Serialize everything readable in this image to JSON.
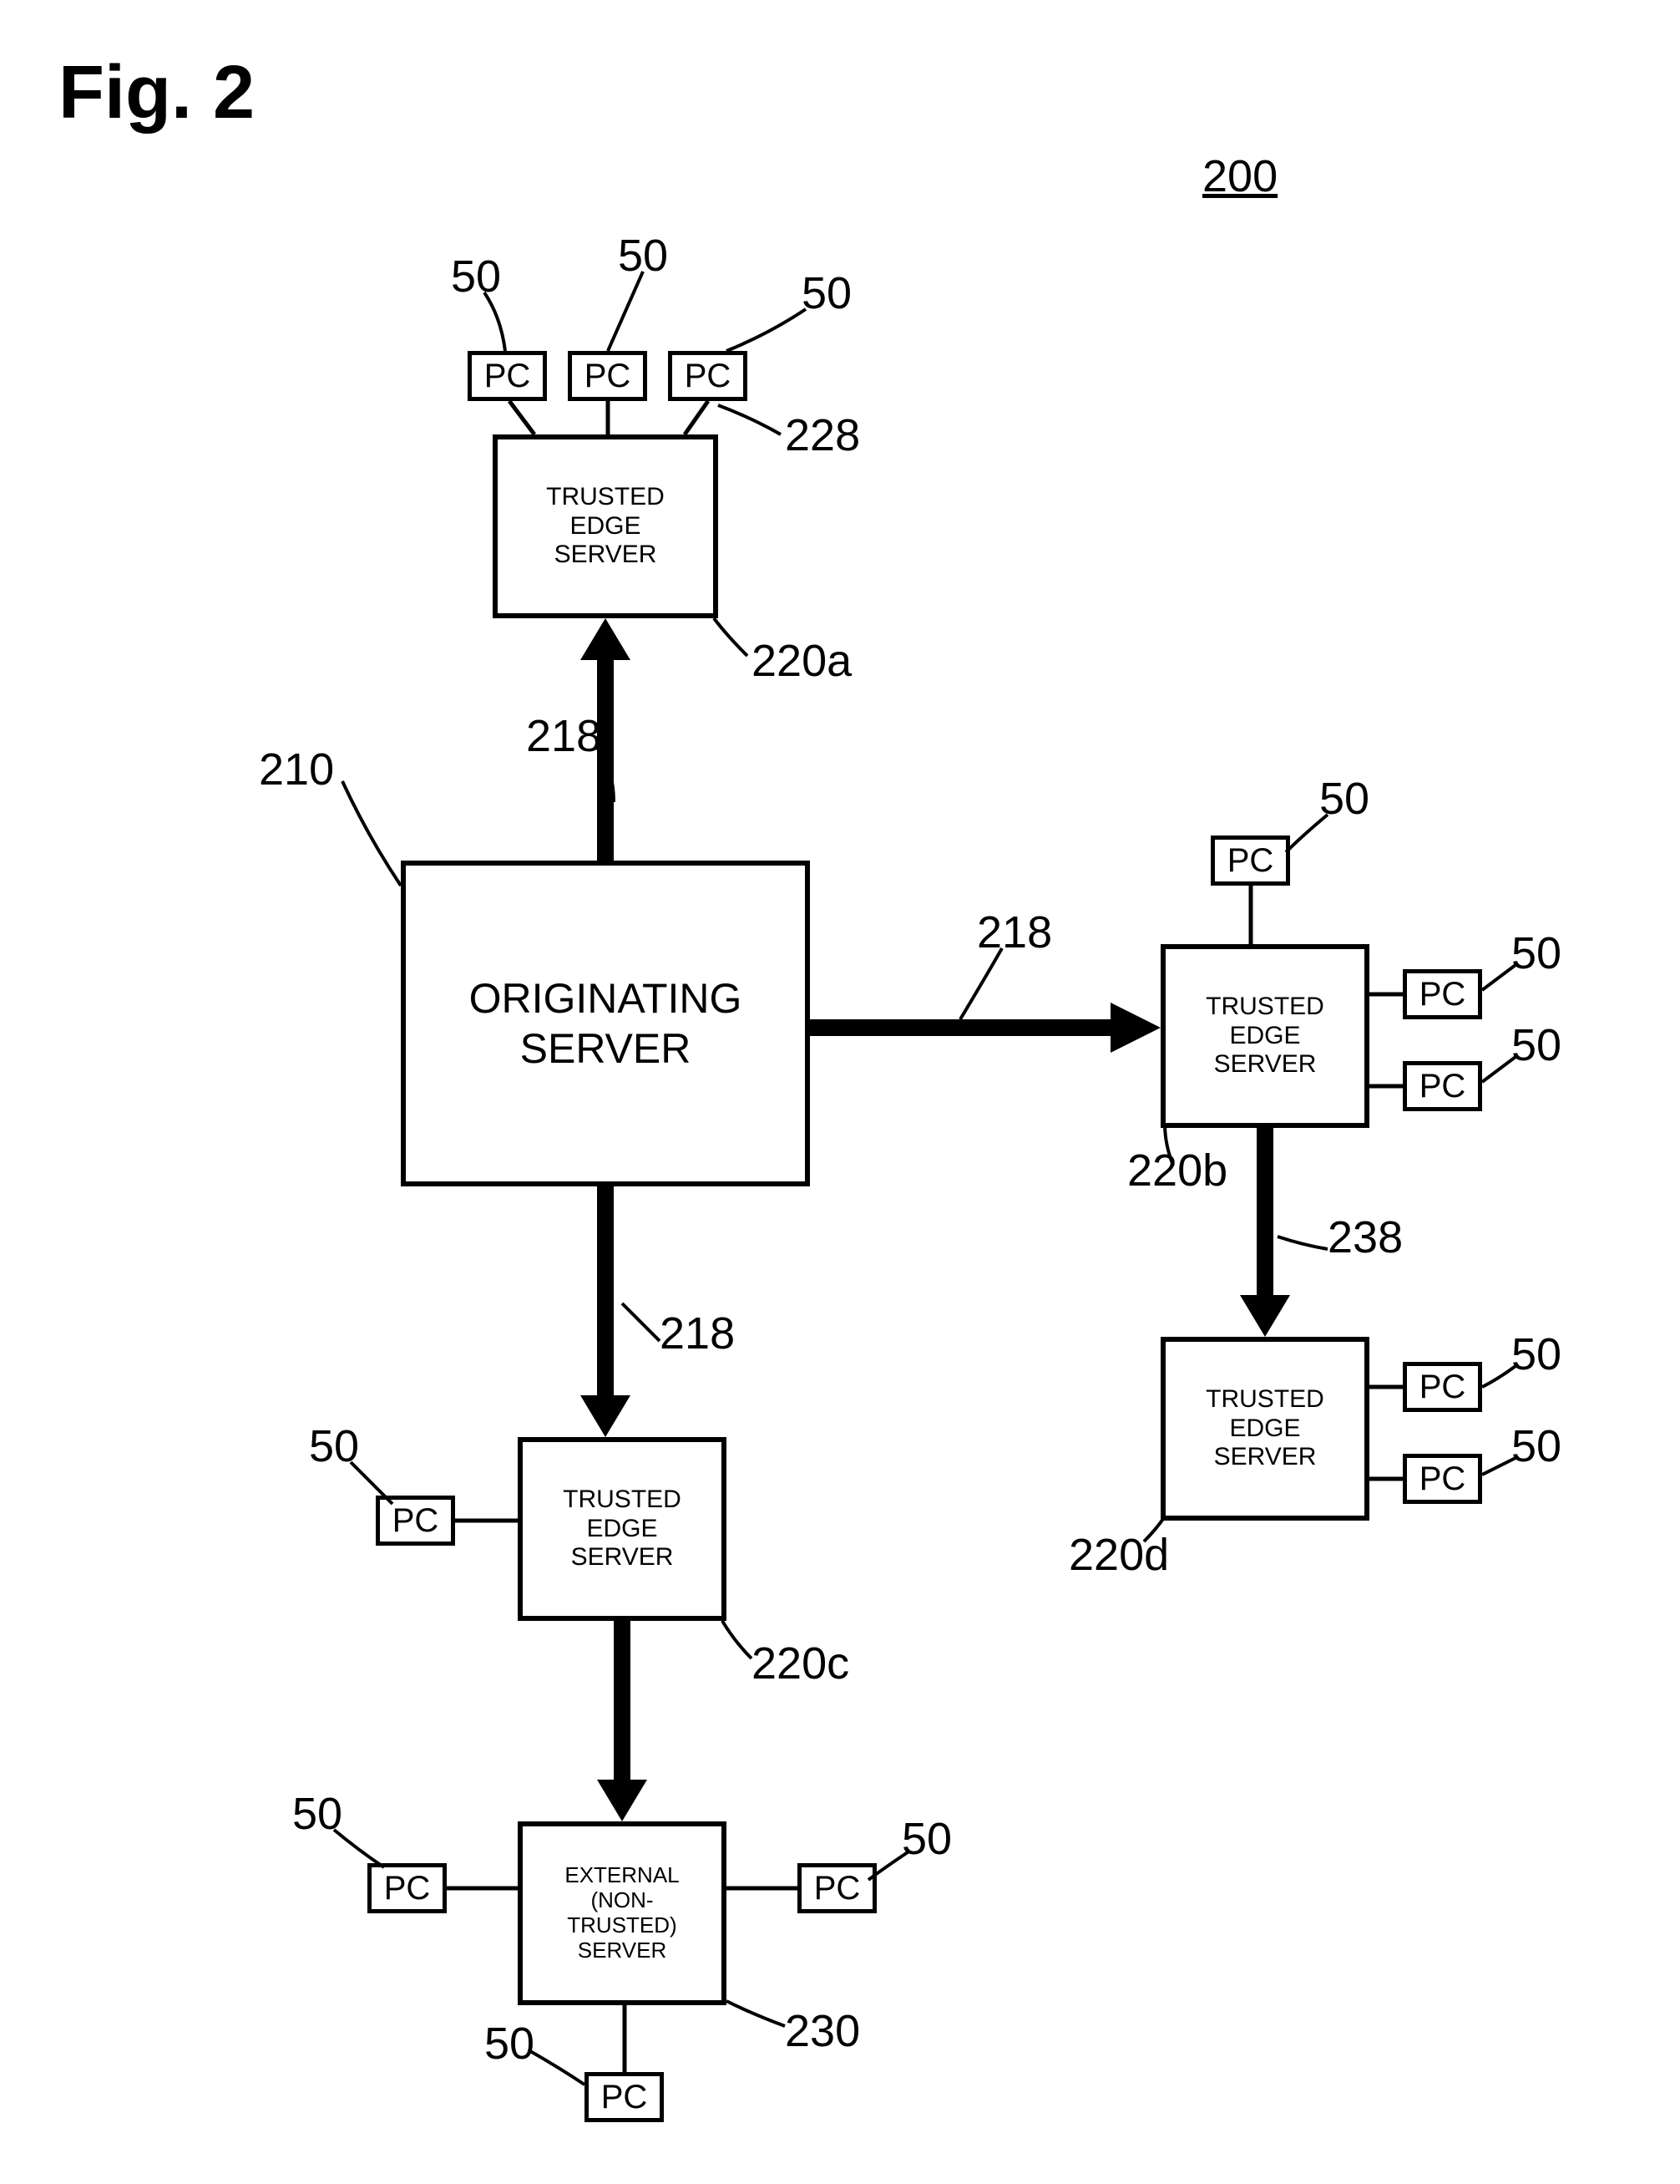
{
  "figure": {
    "title": "Fig. 2",
    "system_ref": "200"
  },
  "nodes": {
    "originating_server": {
      "label": "ORIGINATING\nSERVER",
      "ref": "210"
    },
    "trusted_edge_a": {
      "label": "TRUSTED\nEDGE\nSERVER",
      "ref": "220a"
    },
    "trusted_edge_b": {
      "label": "TRUSTED\nEDGE\nSERVER",
      "ref": "220b"
    },
    "trusted_edge_c": {
      "label": "TRUSTED\nEDGE\nSERVER",
      "ref": "220c"
    },
    "trusted_edge_d": {
      "label": "TRUSTED\nEDGE\nSERVER",
      "ref": "220d"
    },
    "external_server": {
      "label": "EXTERNAL\n(NON-\nTRUSTED)\nSERVER",
      "ref": "230"
    }
  },
  "pc": {
    "label": "PC",
    "ref": "50"
  },
  "links": {
    "link_218_up": "218",
    "link_218_right": "218",
    "link_218_down": "218",
    "link_228": "228",
    "link_238": "238"
  }
}
